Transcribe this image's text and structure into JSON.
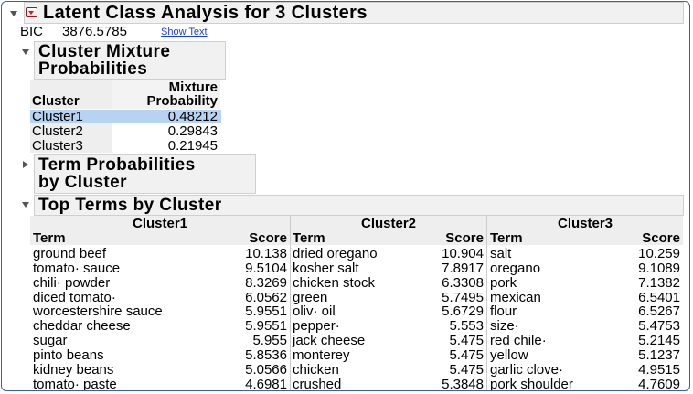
{
  "title": "Latent Class Analysis for 3 Clusters",
  "bic": {
    "label": "BIC",
    "value": "3876.5785",
    "link": "Show Text"
  },
  "mixture": {
    "title_line1": "Cluster Mixture",
    "title_line2": "Probabilities",
    "col_cluster": "Cluster",
    "col_prob_line1": "Mixture",
    "col_prob_line2": "Probability",
    "rows": [
      {
        "cluster": "Cluster1",
        "prob": "0.48212"
      },
      {
        "cluster": "Cluster2",
        "prob": "0.29843"
      },
      {
        "cluster": "Cluster3",
        "prob": "0.21945"
      }
    ]
  },
  "term_prob": {
    "title_line1": "Term Probabilities",
    "title_line2": "by Cluster"
  },
  "top_terms": {
    "title": "Top Terms by Cluster",
    "term_header": "Term",
    "score_header": "Score",
    "clusters": [
      {
        "name": "Cluster1",
        "rows": [
          {
            "term": "ground beef",
            "score": "10.138"
          },
          {
            "term": "tomato· sauce",
            "score": "9.5104"
          },
          {
            "term": "chili· powder",
            "score": "8.3269"
          },
          {
            "term": "diced tomato·",
            "score": "6.0562"
          },
          {
            "term": "worcestershire sauce",
            "score": "5.9551"
          },
          {
            "term": "cheddar cheese",
            "score": "5.9551"
          },
          {
            "term": "sugar",
            "score": "5.955"
          },
          {
            "term": "pinto beans",
            "score": "5.8536"
          },
          {
            "term": "kidney beans",
            "score": "5.0566"
          },
          {
            "term": "tomato· paste",
            "score": "4.6981"
          }
        ]
      },
      {
        "name": "Cluster2",
        "rows": [
          {
            "term": "dried oregano",
            "score": "10.904"
          },
          {
            "term": "kosher salt",
            "score": "7.8917"
          },
          {
            "term": "chicken stock",
            "score": "6.3308"
          },
          {
            "term": "green",
            "score": "5.7495"
          },
          {
            "term": "oliv· oil",
            "score": "5.6729"
          },
          {
            "term": "pepper·",
            "score": "5.553"
          },
          {
            "term": "jack cheese",
            "score": "5.475"
          },
          {
            "term": "monterey",
            "score": "5.475"
          },
          {
            "term": "chicken",
            "score": "5.475"
          },
          {
            "term": "crushed",
            "score": "5.3848"
          }
        ]
      },
      {
        "name": "Cluster3",
        "rows": [
          {
            "term": "salt",
            "score": "10.259"
          },
          {
            "term": "oregano",
            "score": "9.1089"
          },
          {
            "term": "pork",
            "score": "7.1382"
          },
          {
            "term": "mexican",
            "score": "6.5401"
          },
          {
            "term": "flour",
            "score": "6.5267"
          },
          {
            "term": "size·",
            "score": "5.4753"
          },
          {
            "term": "red chile·",
            "score": "5.2145"
          },
          {
            "term": "yellow",
            "score": "5.1237"
          },
          {
            "term": "garlic clove·",
            "score": "4.9515"
          },
          {
            "term": "pork shoulder",
            "score": "4.7609"
          }
        ]
      }
    ]
  },
  "colors": {
    "selected_row": "#b7d3f2",
    "header_bg": "#f1f1f1",
    "link": "#1a3fd6",
    "menu_arrow": "#cc1e1e"
  },
  "icons": [
    "disclosure-open-icon",
    "disclosure-closed-icon",
    "red-triangle-menu-icon"
  ]
}
